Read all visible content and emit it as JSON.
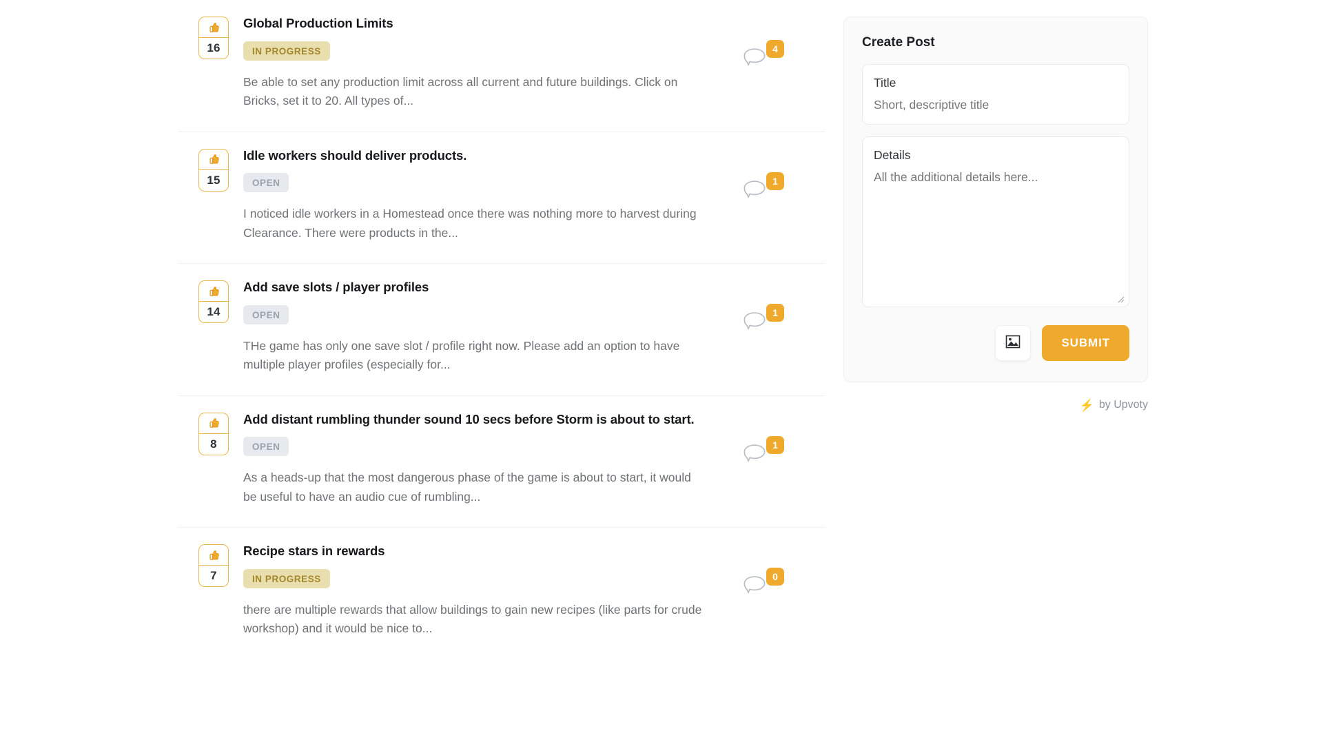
{
  "theme": {
    "accent": "#efa92c",
    "vote_border": "#e8b84a",
    "badge_inprogress_bg": "#e9dfae",
    "badge_inprogress_text": "#a4862a",
    "badge_open_bg": "#e6e9ed",
    "badge_open_text": "#9aa3ad"
  },
  "feed": {
    "posts": [
      {
        "title": "Global Production Limits",
        "status": "IN PROGRESS",
        "status_kind": "inprogress",
        "excerpt": "Be able to set any production limit across all current and future buildings. Click on Bricks, set it to 20. All types of...",
        "votes": "16",
        "comments": "4",
        "vote_icon": "thumbs-up-icon",
        "comment_icon": "comment-bubble-icon"
      },
      {
        "title": "Idle workers should deliver products.",
        "status": "OPEN",
        "status_kind": "open",
        "excerpt": "I noticed idle workers in a Homestead once there was nothing more to harvest during Clearance. There were products in the...",
        "votes": "15",
        "comments": "1",
        "vote_icon": "thumbs-up-icon",
        "comment_icon": "comment-bubble-icon"
      },
      {
        "title": "Add save slots / player profiles",
        "status": "OPEN",
        "status_kind": "open",
        "excerpt": "THe game has only one save slot / profile right now. Please add an option to have multiple player profiles (especially for...",
        "votes": "14",
        "comments": "1",
        "vote_icon": "thumbs-up-icon",
        "comment_icon": "comment-bubble-icon"
      },
      {
        "title": "Add distant rumbling thunder sound 10 secs before Storm is about to start.",
        "status": "OPEN",
        "status_kind": "open",
        "excerpt": "As a heads-up that the most dangerous phase of the game is about to start, it would be useful to have an audio cue of rumbling...",
        "votes": "8",
        "comments": "1",
        "vote_icon": "thumbs-up-icon",
        "comment_icon": "comment-bubble-icon"
      },
      {
        "title": "Recipe stars in rewards",
        "status": "IN PROGRESS",
        "status_kind": "inprogress",
        "excerpt": "there are multiple rewards that allow buildings to gain new recipes (like parts for crude workshop) and it would be nice to...",
        "votes": "7",
        "comments": "0",
        "vote_icon": "thumbs-up-icon",
        "comment_icon": "comment-bubble-icon"
      }
    ]
  },
  "create_post": {
    "heading": "Create Post",
    "title_field": {
      "label": "Title",
      "placeholder": "Short, descriptive title",
      "value": ""
    },
    "details_field": {
      "label": "Details",
      "placeholder": "All the additional details here...",
      "value": ""
    },
    "image_button_icon": "image-icon",
    "submit_label": "SUBMIT"
  },
  "footer": {
    "bolt_icon": "⚡",
    "text": "by Upvoty"
  }
}
